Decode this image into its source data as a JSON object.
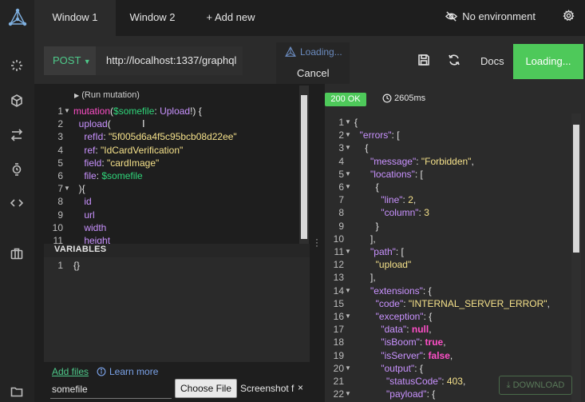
{
  "colors": {
    "accent": "#4ec95a",
    "method": "#4ec98a",
    "keyword": "#ff4fc8",
    "variable": "#2fd67a",
    "field": "#c992ff",
    "string": "#f5e18a",
    "link": "#7aa2e8"
  },
  "sidebar": {
    "icons": [
      "logo-icon",
      "loader-icon",
      "cube-icon",
      "swap-icon",
      "watch-icon",
      "code-icon",
      "briefcase-icon",
      "folder-icon"
    ]
  },
  "tabs": [
    {
      "label": "Window 1",
      "active": true
    },
    {
      "label": "Window 2",
      "active": false
    }
  ],
  "add_window": "+ Add new",
  "environment": "No environment",
  "request": {
    "method": "POST",
    "url": "http://localhost:1337/graphql",
    "loading": "Loading...",
    "cancel": "Cancel",
    "docs": "Docs",
    "send": "Loading..."
  },
  "query": {
    "run_mutation": "(Run mutation)",
    "lines": [
      {
        "n": "1",
        "fold": true,
        "parts": [
          [
            "kw",
            "mutation"
          ],
          [
            "punc",
            "("
          ],
          [
            "var",
            "$somefile"
          ],
          [
            "punc",
            ": "
          ],
          [
            "typ",
            "Upload"
          ],
          [
            "punc",
            "!) {"
          ]
        ]
      },
      {
        "n": "2",
        "fold": false,
        "parts": [
          [
            "fld",
            "  upload"
          ],
          [
            "punc",
            "("
          ]
        ]
      },
      {
        "n": "3",
        "fold": false,
        "parts": [
          [
            "fld",
            "    refId"
          ],
          [
            "punc",
            ": "
          ],
          [
            "str",
            "\"5f005d6a4f5c95bcb08d22ee\""
          ]
        ]
      },
      {
        "n": "4",
        "fold": false,
        "parts": [
          [
            "fld",
            "    ref"
          ],
          [
            "punc",
            ": "
          ],
          [
            "str",
            "\"IdCardVerification\""
          ]
        ]
      },
      {
        "n": "5",
        "fold": false,
        "parts": [
          [
            "fld",
            "    field"
          ],
          [
            "punc",
            ": "
          ],
          [
            "str",
            "\"cardImage\""
          ]
        ]
      },
      {
        "n": "6",
        "fold": false,
        "parts": [
          [
            "fld",
            "    file"
          ],
          [
            "punc",
            ": "
          ],
          [
            "var",
            "$somefile"
          ]
        ]
      },
      {
        "n": "7",
        "fold": true,
        "parts": [
          [
            "punc",
            "  ){"
          ]
        ]
      },
      {
        "n": "8",
        "fold": false,
        "parts": [
          [
            "fld",
            "    id"
          ]
        ]
      },
      {
        "n": "9",
        "fold": false,
        "parts": [
          [
            "fld",
            "    url"
          ]
        ]
      },
      {
        "n": "10",
        "fold": false,
        "parts": [
          [
            "fld",
            "    width"
          ]
        ]
      },
      {
        "n": "11",
        "fold": false,
        "parts": [
          [
            "fld",
            "    height"
          ]
        ]
      }
    ]
  },
  "variables": {
    "title": "VARIABLES",
    "line_no": "1",
    "content": "{}"
  },
  "files": {
    "add": "Add files",
    "learn": "Learn more",
    "name": "somefile",
    "choose": "Choose File",
    "selected": "Screenshot f",
    "remove": "×"
  },
  "response": {
    "status": "200 OK",
    "time": "2605ms",
    "download": "DOWNLOAD",
    "lines": [
      {
        "n": "1",
        "fold": true,
        "parts": [
          [
            "punc",
            "{"
          ]
        ]
      },
      {
        "n": "2",
        "fold": true,
        "parts": [
          [
            "jk",
            "  \"errors\""
          ],
          [
            "punc",
            ": ["
          ]
        ]
      },
      {
        "n": "3",
        "fold": true,
        "parts": [
          [
            "punc",
            "    {"
          ]
        ]
      },
      {
        "n": "4",
        "fold": false,
        "parts": [
          [
            "jk",
            "      \"message\""
          ],
          [
            "punc",
            ": "
          ],
          [
            "js",
            "\"Forbidden\""
          ],
          [
            "punc",
            ","
          ]
        ]
      },
      {
        "n": "5",
        "fold": true,
        "parts": [
          [
            "jk",
            "      \"locations\""
          ],
          [
            "punc",
            ": ["
          ]
        ]
      },
      {
        "n": "6",
        "fold": true,
        "parts": [
          [
            "punc",
            "        {"
          ]
        ]
      },
      {
        "n": "7",
        "fold": false,
        "parts": [
          [
            "jk",
            "          \"line\""
          ],
          [
            "punc",
            ": "
          ],
          [
            "jn",
            "2"
          ],
          [
            "punc",
            ","
          ]
        ]
      },
      {
        "n": "8",
        "fold": false,
        "parts": [
          [
            "jk",
            "          \"column\""
          ],
          [
            "punc",
            ": "
          ],
          [
            "jn",
            "3"
          ]
        ]
      },
      {
        "n": "9",
        "fold": false,
        "parts": [
          [
            "punc",
            "        }"
          ]
        ]
      },
      {
        "n": "10",
        "fold": false,
        "parts": [
          [
            "punc",
            "      ],"
          ]
        ]
      },
      {
        "n": "11",
        "fold": true,
        "parts": [
          [
            "jk",
            "      \"path\""
          ],
          [
            "punc",
            ": ["
          ]
        ]
      },
      {
        "n": "12",
        "fold": false,
        "parts": [
          [
            "js",
            "        \"upload\""
          ]
        ]
      },
      {
        "n": "13",
        "fold": false,
        "parts": [
          [
            "punc",
            "      ],"
          ]
        ]
      },
      {
        "n": "14",
        "fold": true,
        "parts": [
          [
            "jk",
            "      \"extensions\""
          ],
          [
            "punc",
            ": {"
          ]
        ]
      },
      {
        "n": "15",
        "fold": false,
        "parts": [
          [
            "jk",
            "        \"code\""
          ],
          [
            "punc",
            ": "
          ],
          [
            "js",
            "\"INTERNAL_SERVER_ERROR\""
          ],
          [
            "punc",
            ","
          ]
        ]
      },
      {
        "n": "16",
        "fold": true,
        "parts": [
          [
            "jk",
            "        \"exception\""
          ],
          [
            "punc",
            ": {"
          ]
        ]
      },
      {
        "n": "17",
        "fold": false,
        "parts": [
          [
            "jk",
            "          \"data\""
          ],
          [
            "punc",
            ": "
          ],
          [
            "jb",
            "null"
          ],
          [
            "punc",
            ","
          ]
        ]
      },
      {
        "n": "18",
        "fold": false,
        "parts": [
          [
            "jk",
            "          \"isBoom\""
          ],
          [
            "punc",
            ": "
          ],
          [
            "jb",
            "true"
          ],
          [
            "punc",
            ","
          ]
        ]
      },
      {
        "n": "19",
        "fold": false,
        "parts": [
          [
            "jk",
            "          \"isServer\""
          ],
          [
            "punc",
            ": "
          ],
          [
            "jb",
            "false"
          ],
          [
            "punc",
            ","
          ]
        ]
      },
      {
        "n": "20",
        "fold": true,
        "parts": [
          [
            "jk",
            "          \"output\""
          ],
          [
            "punc",
            ": {"
          ]
        ]
      },
      {
        "n": "21",
        "fold": false,
        "parts": [
          [
            "jk",
            "            \"statusCode\""
          ],
          [
            "punc",
            ": "
          ],
          [
            "jn",
            "403"
          ],
          [
            "punc",
            ","
          ]
        ]
      },
      {
        "n": "22",
        "fold": true,
        "parts": [
          [
            "jk",
            "            \"payload\""
          ],
          [
            "punc",
            ": {"
          ]
        ]
      }
    ]
  }
}
